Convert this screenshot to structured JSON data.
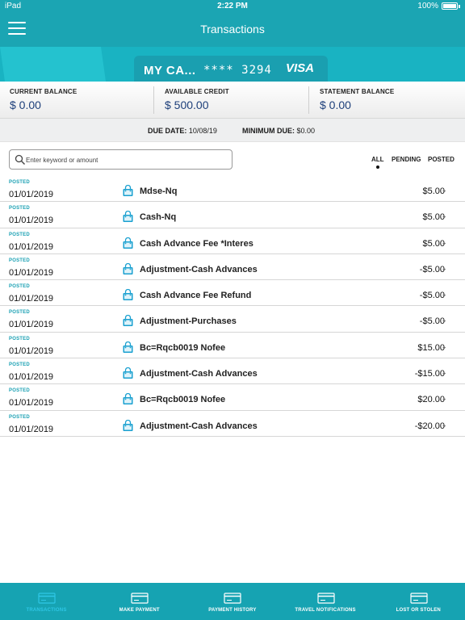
{
  "status_bar": {
    "device": "iPad",
    "time": "2:22 PM",
    "battery": "100%"
  },
  "header": {
    "title": "Transactions"
  },
  "card": {
    "name": "MY CA...",
    "number": "**** 3294",
    "brand": "VISA"
  },
  "balances": [
    {
      "label": "CURRENT BALANCE",
      "value": "$ 0.00"
    },
    {
      "label": "AVAILABLE CREDIT",
      "value": "$ 500.00"
    },
    {
      "label": "STATEMENT BALANCE",
      "value": "$ 0.00"
    }
  ],
  "due": {
    "due_label": "DUE DATE:",
    "due_value": "10/08/19",
    "min_label": "MINIMUM DUE:",
    "min_value": "$0.00"
  },
  "search": {
    "placeholder": "Enter keyword or amount"
  },
  "filters": {
    "all": "ALL",
    "pending": "PENDING",
    "posted": "POSTED",
    "selected": "ALL"
  },
  "transactions": [
    {
      "status": "POSTED",
      "date": "01/01/2019",
      "description": "Mdse-Nq",
      "amount": "$5.00"
    },
    {
      "status": "POSTED",
      "date": "01/01/2019",
      "description": "Cash-Nq",
      "amount": "$5.00"
    },
    {
      "status": "POSTED",
      "date": "01/01/2019",
      "description": "Cash Advance Fee *Interes",
      "amount": "$5.00"
    },
    {
      "status": "POSTED",
      "date": "01/01/2019",
      "description": "Adjustment-Cash Advances",
      "amount": "-$5.00"
    },
    {
      "status": "POSTED",
      "date": "01/01/2019",
      "description": "Cash Advance Fee Refund",
      "amount": "-$5.00"
    },
    {
      "status": "POSTED",
      "date": "01/01/2019",
      "description": "Adjustment-Purchases",
      "amount": "-$5.00"
    },
    {
      "status": "POSTED",
      "date": "01/01/2019",
      "description": "Bc=Rqcb0019 Nofee",
      "amount": "$15.00"
    },
    {
      "status": "POSTED",
      "date": "01/01/2019",
      "description": "Adjustment-Cash Advances",
      "amount": "-$15.00"
    },
    {
      "status": "POSTED",
      "date": "01/01/2019",
      "description": "Bc=Rqcb0019 Nofee",
      "amount": "$20.00"
    },
    {
      "status": "POSTED",
      "date": "01/01/2019",
      "description": "Adjustment-Cash Advances",
      "amount": "-$20.00"
    }
  ],
  "tabs": [
    {
      "label": "TRANSACTIONS",
      "icon": "card-icon",
      "active": true
    },
    {
      "label": "MAKE PAYMENT",
      "icon": "card-icon",
      "active": false
    },
    {
      "label": "PAYMENT HISTORY",
      "icon": "calendar-icon",
      "active": false
    },
    {
      "label": "TRAVEL NOTIFICATIONS",
      "icon": "airplane-card-icon",
      "active": false
    },
    {
      "label": "LOST OR STOLEN",
      "icon": "card-icon",
      "active": false
    }
  ],
  "colors": {
    "primary": "#1ba5b3",
    "amount_text": "#1d3f7a",
    "posted_text": "#1aa0b3",
    "active_tab": "#2fc7e6"
  }
}
